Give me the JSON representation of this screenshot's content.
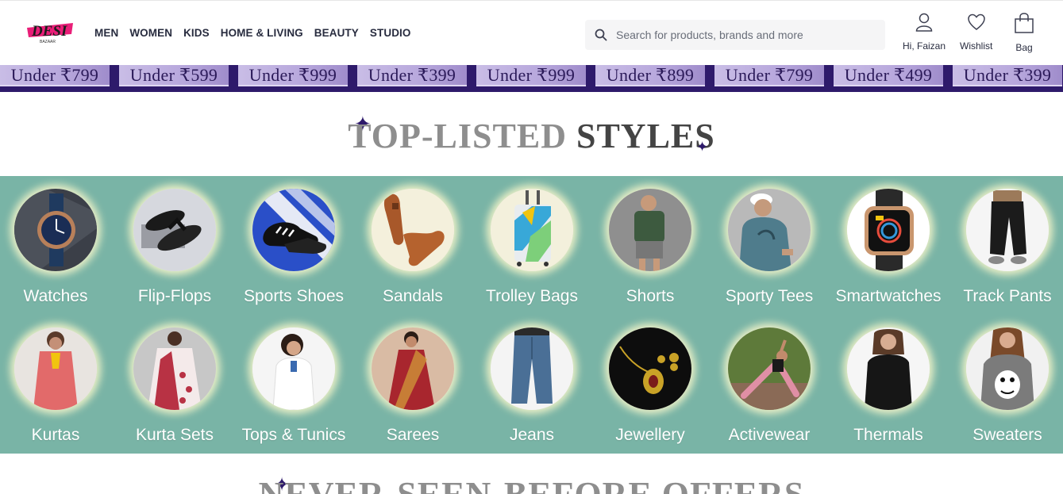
{
  "brand": {
    "name": "DESI",
    "sub": "BAZAAR",
    "colors": {
      "pink": "#e91e78",
      "navy": "#2e1a6b"
    }
  },
  "nav": [
    "MEN",
    "WOMEN",
    "KIDS",
    "HOME & LIVING",
    "BEAUTY",
    "STUDIO"
  ],
  "search": {
    "placeholder": "Search for products, brands and more",
    "icon": "search-icon"
  },
  "actions": [
    {
      "label": "Hi, Faizan",
      "icon": "user-icon"
    },
    {
      "label": "Wishlist",
      "icon": "heart-icon"
    },
    {
      "label": "Bag",
      "icon": "bag-icon"
    }
  ],
  "price_strip": [
    "Under ₹799",
    "Under ₹599",
    "Under ₹999",
    "Under ₹399",
    "Under ₹999",
    "Under ₹899",
    "Under ₹799",
    "Under ₹499",
    "Under ₹399"
  ],
  "section_top": {
    "light": "TOP-LISTED",
    "dark": "STYLES"
  },
  "categories_row1": [
    "Watches",
    "Flip-Flops",
    "Sports Shoes",
    "Sandals",
    "Trolley Bags",
    "Shorts",
    "Sporty Tees",
    "Smartwatches",
    "Track Pants"
  ],
  "categories_row2": [
    "Kurtas",
    "Kurta Sets",
    "Tops & Tunics",
    "Sarees",
    "Jeans",
    "Jewellery",
    "Activewear",
    "Thermals",
    "Sweaters"
  ],
  "section_next": {
    "title": "NEVER-SEEN-BEFORE OFFERS"
  },
  "colors": {
    "grid_bg": "#79b4a6",
    "strip_bg": "#2e1a6b",
    "glow": "#fffacd"
  }
}
